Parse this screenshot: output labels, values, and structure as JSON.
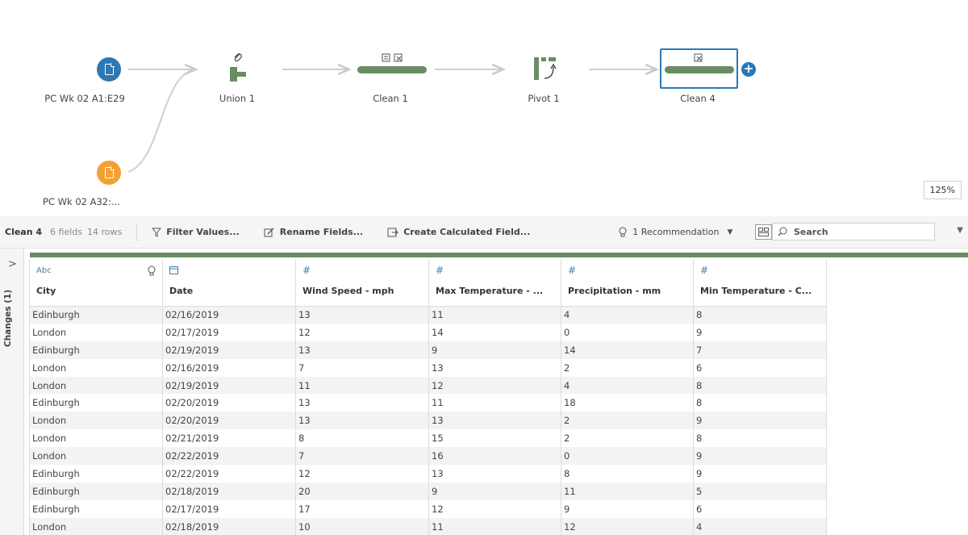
{
  "flow": {
    "nodes": {
      "input1": {
        "label": "PC Wk 02 A1:E29"
      },
      "input2": {
        "label": "PC Wk 02 A32:..."
      },
      "union": {
        "label": "Union 1"
      },
      "clean1": {
        "label": "Clean 1"
      },
      "pivot": {
        "label": "Pivot 1"
      },
      "clean4": {
        "label": "Clean 4"
      }
    },
    "zoom": "125%",
    "colors": {
      "input1": "#2b78b4",
      "input2": "#f4a134",
      "clean": "#6a8c63",
      "accent": "#2b78b4"
    }
  },
  "toolbar": {
    "step_name": "Clean 4",
    "fields": "6 fields",
    "rows": "14 rows",
    "filter_label": "Filter Values...",
    "rename_label": "Rename Fields...",
    "calc_label": "Create Calculated Field...",
    "recommendation": "1 Recommendation",
    "search_label": "Search"
  },
  "side_panel": {
    "label": "Changes (1)"
  },
  "table": {
    "columns": [
      {
        "type_icon": "Abc",
        "name": "City"
      },
      {
        "type_icon": "calendar-icon",
        "name": "Date"
      },
      {
        "type_icon": "#",
        "name": "Wind Speed - mph"
      },
      {
        "type_icon": "#",
        "name": "Max Temperature - ..."
      },
      {
        "type_icon": "#",
        "name": "Precipitation - mm"
      },
      {
        "type_icon": "#",
        "name": "Min Temperature - C..."
      }
    ],
    "rows": [
      [
        "Edinburgh",
        "02/16/2019",
        "13",
        "11",
        "4",
        "8"
      ],
      [
        "London",
        "02/17/2019",
        "12",
        "14",
        "0",
        "9"
      ],
      [
        "Edinburgh",
        "02/19/2019",
        "13",
        "9",
        "14",
        "7"
      ],
      [
        "London",
        "02/16/2019",
        "7",
        "13",
        "2",
        "6"
      ],
      [
        "London",
        "02/19/2019",
        "11",
        "12",
        "4",
        "8"
      ],
      [
        "Edinburgh",
        "02/20/2019",
        "13",
        "11",
        "18",
        "8"
      ],
      [
        "London",
        "02/20/2019",
        "13",
        "13",
        "2",
        "9"
      ],
      [
        "London",
        "02/21/2019",
        "8",
        "15",
        "2",
        "8"
      ],
      [
        "London",
        "02/22/2019",
        "7",
        "16",
        "0",
        "9"
      ],
      [
        "Edinburgh",
        "02/22/2019",
        "12",
        "13",
        "8",
        "9"
      ],
      [
        "Edinburgh",
        "02/18/2019",
        "20",
        "9",
        "11",
        "5"
      ],
      [
        "Edinburgh",
        "02/17/2019",
        "17",
        "12",
        "9",
        "6"
      ],
      [
        "London",
        "02/18/2019",
        "10",
        "11",
        "12",
        "4"
      ]
    ]
  }
}
